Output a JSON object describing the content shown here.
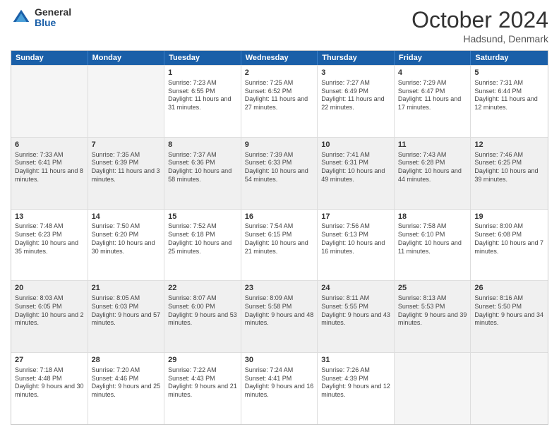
{
  "header": {
    "logo_general": "General",
    "logo_blue": "Blue",
    "month_title": "October 2024",
    "location": "Hadsund, Denmark"
  },
  "days_of_week": [
    "Sunday",
    "Monday",
    "Tuesday",
    "Wednesday",
    "Thursday",
    "Friday",
    "Saturday"
  ],
  "weeks": [
    [
      {
        "day": "",
        "sunrise": "",
        "sunset": "",
        "daylight": "",
        "empty": true
      },
      {
        "day": "",
        "sunrise": "",
        "sunset": "",
        "daylight": "",
        "empty": true
      },
      {
        "day": "1",
        "sunrise": "Sunrise: 7:23 AM",
        "sunset": "Sunset: 6:55 PM",
        "daylight": "Daylight: 11 hours and 31 minutes.",
        "empty": false
      },
      {
        "day": "2",
        "sunrise": "Sunrise: 7:25 AM",
        "sunset": "Sunset: 6:52 PM",
        "daylight": "Daylight: 11 hours and 27 minutes.",
        "empty": false
      },
      {
        "day": "3",
        "sunrise": "Sunrise: 7:27 AM",
        "sunset": "Sunset: 6:49 PM",
        "daylight": "Daylight: 11 hours and 22 minutes.",
        "empty": false
      },
      {
        "day": "4",
        "sunrise": "Sunrise: 7:29 AM",
        "sunset": "Sunset: 6:47 PM",
        "daylight": "Daylight: 11 hours and 17 minutes.",
        "empty": false
      },
      {
        "day": "5",
        "sunrise": "Sunrise: 7:31 AM",
        "sunset": "Sunset: 6:44 PM",
        "daylight": "Daylight: 11 hours and 12 minutes.",
        "empty": false
      }
    ],
    [
      {
        "day": "6",
        "sunrise": "Sunrise: 7:33 AM",
        "sunset": "Sunset: 6:41 PM",
        "daylight": "Daylight: 11 hours and 8 minutes.",
        "empty": false
      },
      {
        "day": "7",
        "sunrise": "Sunrise: 7:35 AM",
        "sunset": "Sunset: 6:39 PM",
        "daylight": "Daylight: 11 hours and 3 minutes.",
        "empty": false
      },
      {
        "day": "8",
        "sunrise": "Sunrise: 7:37 AM",
        "sunset": "Sunset: 6:36 PM",
        "daylight": "Daylight: 10 hours and 58 minutes.",
        "empty": false
      },
      {
        "day": "9",
        "sunrise": "Sunrise: 7:39 AM",
        "sunset": "Sunset: 6:33 PM",
        "daylight": "Daylight: 10 hours and 54 minutes.",
        "empty": false
      },
      {
        "day": "10",
        "sunrise": "Sunrise: 7:41 AM",
        "sunset": "Sunset: 6:31 PM",
        "daylight": "Daylight: 10 hours and 49 minutes.",
        "empty": false
      },
      {
        "day": "11",
        "sunrise": "Sunrise: 7:43 AM",
        "sunset": "Sunset: 6:28 PM",
        "daylight": "Daylight: 10 hours and 44 minutes.",
        "empty": false
      },
      {
        "day": "12",
        "sunrise": "Sunrise: 7:46 AM",
        "sunset": "Sunset: 6:25 PM",
        "daylight": "Daylight: 10 hours and 39 minutes.",
        "empty": false
      }
    ],
    [
      {
        "day": "13",
        "sunrise": "Sunrise: 7:48 AM",
        "sunset": "Sunset: 6:23 PM",
        "daylight": "Daylight: 10 hours and 35 minutes.",
        "empty": false
      },
      {
        "day": "14",
        "sunrise": "Sunrise: 7:50 AM",
        "sunset": "Sunset: 6:20 PM",
        "daylight": "Daylight: 10 hours and 30 minutes.",
        "empty": false
      },
      {
        "day": "15",
        "sunrise": "Sunrise: 7:52 AM",
        "sunset": "Sunset: 6:18 PM",
        "daylight": "Daylight: 10 hours and 25 minutes.",
        "empty": false
      },
      {
        "day": "16",
        "sunrise": "Sunrise: 7:54 AM",
        "sunset": "Sunset: 6:15 PM",
        "daylight": "Daylight: 10 hours and 21 minutes.",
        "empty": false
      },
      {
        "day": "17",
        "sunrise": "Sunrise: 7:56 AM",
        "sunset": "Sunset: 6:13 PM",
        "daylight": "Daylight: 10 hours and 16 minutes.",
        "empty": false
      },
      {
        "day": "18",
        "sunrise": "Sunrise: 7:58 AM",
        "sunset": "Sunset: 6:10 PM",
        "daylight": "Daylight: 10 hours and 11 minutes.",
        "empty": false
      },
      {
        "day": "19",
        "sunrise": "Sunrise: 8:00 AM",
        "sunset": "Sunset: 6:08 PM",
        "daylight": "Daylight: 10 hours and 7 minutes.",
        "empty": false
      }
    ],
    [
      {
        "day": "20",
        "sunrise": "Sunrise: 8:03 AM",
        "sunset": "Sunset: 6:05 PM",
        "daylight": "Daylight: 10 hours and 2 minutes.",
        "empty": false
      },
      {
        "day": "21",
        "sunrise": "Sunrise: 8:05 AM",
        "sunset": "Sunset: 6:03 PM",
        "daylight": "Daylight: 9 hours and 57 minutes.",
        "empty": false
      },
      {
        "day": "22",
        "sunrise": "Sunrise: 8:07 AM",
        "sunset": "Sunset: 6:00 PM",
        "daylight": "Daylight: 9 hours and 53 minutes.",
        "empty": false
      },
      {
        "day": "23",
        "sunrise": "Sunrise: 8:09 AM",
        "sunset": "Sunset: 5:58 PM",
        "daylight": "Daylight: 9 hours and 48 minutes.",
        "empty": false
      },
      {
        "day": "24",
        "sunrise": "Sunrise: 8:11 AM",
        "sunset": "Sunset: 5:55 PM",
        "daylight": "Daylight: 9 hours and 43 minutes.",
        "empty": false
      },
      {
        "day": "25",
        "sunrise": "Sunrise: 8:13 AM",
        "sunset": "Sunset: 5:53 PM",
        "daylight": "Daylight: 9 hours and 39 minutes.",
        "empty": false
      },
      {
        "day": "26",
        "sunrise": "Sunrise: 8:16 AM",
        "sunset": "Sunset: 5:50 PM",
        "daylight": "Daylight: 9 hours and 34 minutes.",
        "empty": false
      }
    ],
    [
      {
        "day": "27",
        "sunrise": "Sunrise: 7:18 AM",
        "sunset": "Sunset: 4:48 PM",
        "daylight": "Daylight: 9 hours and 30 minutes.",
        "empty": false
      },
      {
        "day": "28",
        "sunrise": "Sunrise: 7:20 AM",
        "sunset": "Sunset: 4:46 PM",
        "daylight": "Daylight: 9 hours and 25 minutes.",
        "empty": false
      },
      {
        "day": "29",
        "sunrise": "Sunrise: 7:22 AM",
        "sunset": "Sunset: 4:43 PM",
        "daylight": "Daylight: 9 hours and 21 minutes.",
        "empty": false
      },
      {
        "day": "30",
        "sunrise": "Sunrise: 7:24 AM",
        "sunset": "Sunset: 4:41 PM",
        "daylight": "Daylight: 9 hours and 16 minutes.",
        "empty": false
      },
      {
        "day": "31",
        "sunrise": "Sunrise: 7:26 AM",
        "sunset": "Sunset: 4:39 PM",
        "daylight": "Daylight: 9 hours and 12 minutes.",
        "empty": false
      },
      {
        "day": "",
        "sunrise": "",
        "sunset": "",
        "daylight": "",
        "empty": true
      },
      {
        "day": "",
        "sunrise": "",
        "sunset": "",
        "daylight": "",
        "empty": true
      }
    ]
  ]
}
